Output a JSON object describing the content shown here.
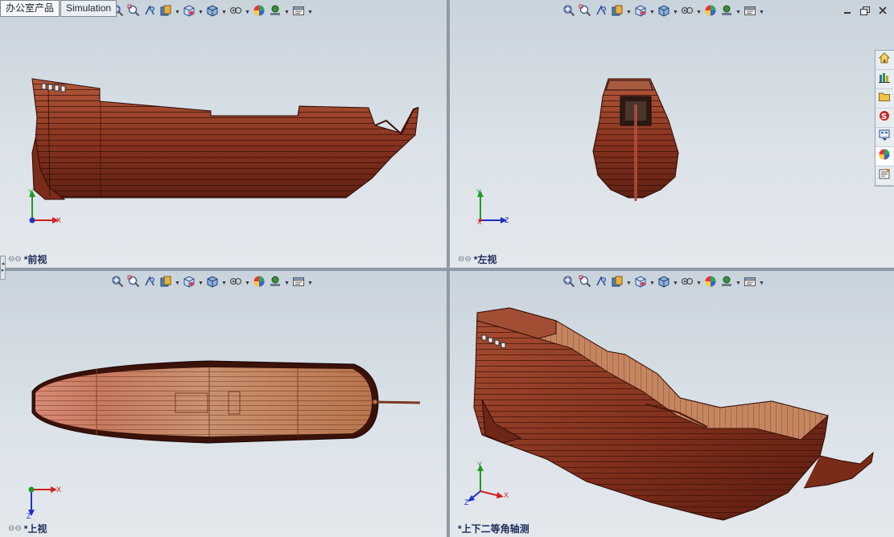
{
  "command_tabs": [
    {
      "label": "办公室产品",
      "active": true
    },
    {
      "label": "Simulation",
      "active": false
    }
  ],
  "viewports": {
    "front": {
      "label": "*前视"
    },
    "left": {
      "label": "*左视"
    },
    "top": {
      "label": "*上视"
    },
    "iso": {
      "label": "*上下二等角轴测"
    }
  },
  "triad_labels": {
    "x": "X",
    "y": "Y",
    "z": "Z"
  },
  "view_toolbar_icons": [
    "zoom-to-fit-icon",
    "zoom-to-area-icon",
    "previous-view-icon",
    "section-view-icon",
    "view-orientation-icon",
    "display-style-icon",
    "hide-show-items-icon",
    "edit-appearance-icon",
    "apply-scene-icon",
    "view-settings-icon"
  ],
  "task_pane_icons": [
    "resources-home-icon",
    "design-library-icon",
    "file-explorer-icon",
    "search-icon",
    "view-palette-icon",
    "appearances-icon",
    "custom-properties-icon"
  ],
  "colors": {
    "hull_dark": "#5a1e12",
    "hull_mid": "#8c3a24",
    "hull_light": "#b8654a",
    "deck": "#c48560",
    "triad_x": "#d42020",
    "triad_y": "#1d9a1d",
    "triad_z": "#2030c0",
    "viewport_bg": "#d6dde4"
  }
}
